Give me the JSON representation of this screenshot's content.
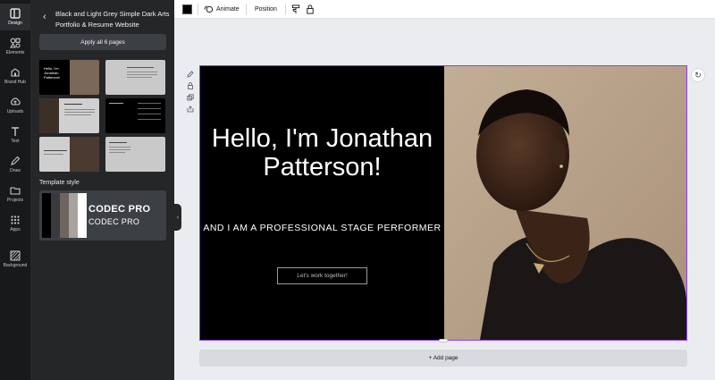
{
  "rail": {
    "items": [
      {
        "label": "Design",
        "icon": "design-icon"
      },
      {
        "label": "Elements",
        "icon": "elements-icon"
      },
      {
        "label": "Brand Hub",
        "icon": "brand-hub-icon"
      },
      {
        "label": "Uploads",
        "icon": "upload-icon"
      },
      {
        "label": "Text",
        "icon": "text-icon"
      },
      {
        "label": "Draw",
        "icon": "draw-icon"
      },
      {
        "label": "Projects",
        "icon": "folder-icon"
      },
      {
        "label": "Apps",
        "icon": "apps-icon"
      },
      {
        "label": "Background",
        "icon": "background-icon"
      }
    ]
  },
  "panel": {
    "title": "Black and Light Grey Simple Dark Arts Portfolio & Resume Website",
    "apply_label": "Apply all 6 pages",
    "template_style_heading": "Template style",
    "style_font_heading": "CODEC PRO",
    "style_font_body": "CODEC PRO",
    "swatches": [
      "#000000",
      "#3a3a3a",
      "#6e6560",
      "#a9a39d",
      "#ffffff"
    ],
    "thumb_title_text": "Hello, I'm Jonathan Patterson!"
  },
  "toolbar": {
    "color": "#000000",
    "animate_label": "Animate",
    "position_label": "Position"
  },
  "slide": {
    "title": "Hello, I'm Jonathan Patterson!",
    "subtitle": "AND I AM A PROFESSIONAL STAGE PERFORMER",
    "cta_label": "Let's work together!",
    "bg_color": "#000000",
    "photo_bg": "#b9a48c"
  },
  "canvas": {
    "add_page_label": "+ Add page",
    "selection_color": "#8b3dff"
  }
}
